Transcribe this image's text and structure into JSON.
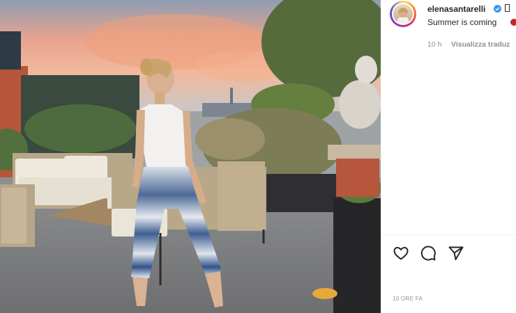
{
  "post": {
    "username": "elenasantarelli",
    "caption": "Summer is coming",
    "time_ago": "10 h",
    "translate_label": "Visualizza traduz",
    "timestamp_footer": "10 ORE FA"
  },
  "icons": {
    "verified": "verified-badge-icon",
    "emoji_placeholder": "missing-glyph-icon",
    "caption_emoji": "red-emoji-icon",
    "like": "heart-icon",
    "comment": "comment-bubble-icon",
    "share": "paper-plane-icon"
  },
  "colors": {
    "verified_blue": "#3897f0",
    "text_primary": "#262626",
    "text_secondary": "#8e8e8e"
  }
}
